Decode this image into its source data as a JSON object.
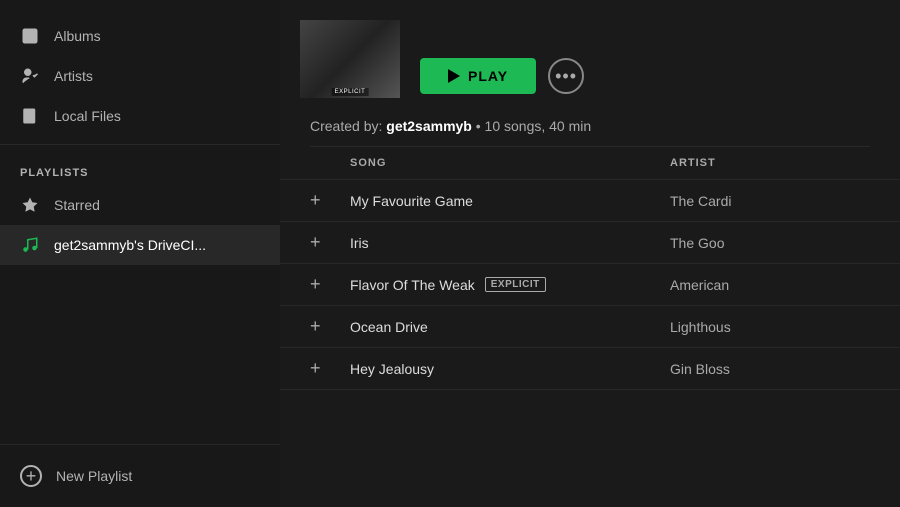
{
  "sidebar": {
    "nav_items": [
      {
        "id": "albums",
        "label": "Albums",
        "icon": "album"
      },
      {
        "id": "artists",
        "label": "Artists",
        "icon": "artist"
      },
      {
        "id": "local-files",
        "label": "Local Files",
        "icon": "local"
      }
    ],
    "section_label": "PLAYLISTS",
    "playlist_items": [
      {
        "id": "starred",
        "label": "Starred",
        "icon": "star",
        "active": false
      },
      {
        "id": "get2sammyb",
        "label": "get2sammyb's DriveCI...",
        "icon": "note",
        "active": true
      }
    ],
    "new_playlist_label": "New Playlist"
  },
  "main": {
    "play_button_label": "PLAY",
    "more_button_label": "···",
    "playlist_meta": {
      "prefix": "Created by:",
      "creator": "get2sammyb",
      "details": "• 10 songs, 40 min"
    },
    "table_headers": {
      "song": "SONG",
      "artist": "ARTIST"
    },
    "songs": [
      {
        "id": 1,
        "title": "My Favourite Game",
        "artist": "The Cardi",
        "explicit": false
      },
      {
        "id": 2,
        "title": "Iris",
        "artist": "The Goo",
        "explicit": false
      },
      {
        "id": 3,
        "title": "Flavor Of The Weak",
        "artist": "American",
        "explicit": true
      },
      {
        "id": 4,
        "title": "Ocean Drive",
        "artist": "Lighthous",
        "explicit": false
      },
      {
        "id": 5,
        "title": "Hey Jealousy",
        "artist": "Gin Bloss",
        "explicit": false
      }
    ],
    "explicit_label": "EXPLICIT",
    "add_icon": "+"
  },
  "colors": {
    "accent": "#1db954",
    "sidebar_bg": "#181818",
    "main_bg": "#1a1a1a",
    "active_item_bg": "#282828"
  }
}
